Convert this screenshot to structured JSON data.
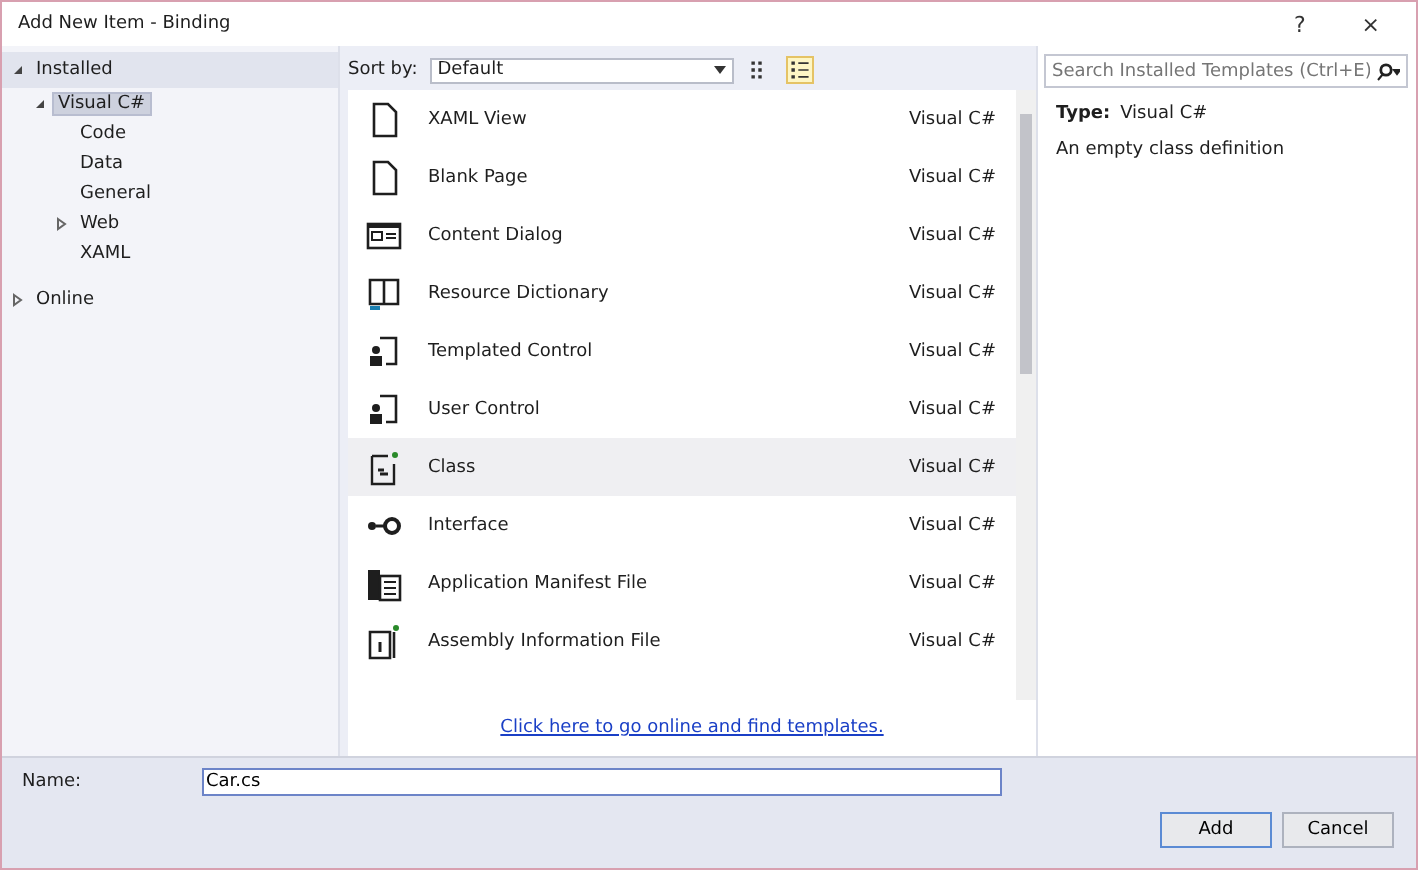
{
  "window": {
    "title": "Add New Item - Binding",
    "help": "?",
    "close": "×"
  },
  "sidebar": {
    "items": [
      {
        "label": "Installed",
        "expanded": true,
        "selected": false,
        "children": [
          {
            "label": "Visual C#",
            "expanded": true,
            "selected": true,
            "children": [
              {
                "label": "Code",
                "selected": false
              },
              {
                "label": "Data",
                "selected": false
              },
              {
                "label": "General",
                "selected": false
              },
              {
                "label": "Web",
                "expanded": false,
                "selected": false
              },
              {
                "label": "XAML",
                "selected": false
              }
            ]
          }
        ]
      },
      {
        "label": "Online",
        "expanded": false,
        "selected": false
      }
    ]
  },
  "toolbar": {
    "sort_label": "Sort by:",
    "sort_value": "Default",
    "views": [
      {
        "kind": "grid",
        "selected": false
      },
      {
        "kind": "list",
        "selected": true
      }
    ]
  },
  "templates": [
    {
      "name": "XAML View",
      "language": "Visual C#",
      "kind": "page",
      "selected": false
    },
    {
      "name": "Blank Page",
      "language": "Visual C#",
      "kind": "page",
      "selected": false
    },
    {
      "name": "Content Dialog",
      "language": "Visual C#",
      "kind": "dialog",
      "selected": false
    },
    {
      "name": "Resource Dictionary",
      "language": "Visual C#",
      "kind": "dictionary",
      "selected": false
    },
    {
      "name": "Templated Control",
      "language": "Visual C#",
      "kind": "control",
      "selected": false
    },
    {
      "name": "User Control",
      "language": "Visual C#",
      "kind": "control",
      "selected": false
    },
    {
      "name": "Class",
      "language": "Visual C#",
      "kind": "class",
      "selected": true
    },
    {
      "name": "Interface",
      "language": "Visual C#",
      "kind": "interface",
      "selected": false
    },
    {
      "name": "Application Manifest File",
      "language": "Visual C#",
      "kind": "manifest",
      "selected": false
    },
    {
      "name": "Assembly Information File",
      "language": "Visual C#",
      "kind": "info",
      "selected": false
    }
  ],
  "online_link": "Click here to go online and find templates.",
  "search": {
    "placeholder": "Search Installed Templates (Ctrl+E)"
  },
  "details": {
    "type_label": "Type:",
    "type_value": "Visual C#",
    "description": "An empty class definition"
  },
  "name_field": {
    "label": "Name:",
    "value": "Car.cs"
  },
  "buttons": [
    "Add",
    "Cancel"
  ]
}
